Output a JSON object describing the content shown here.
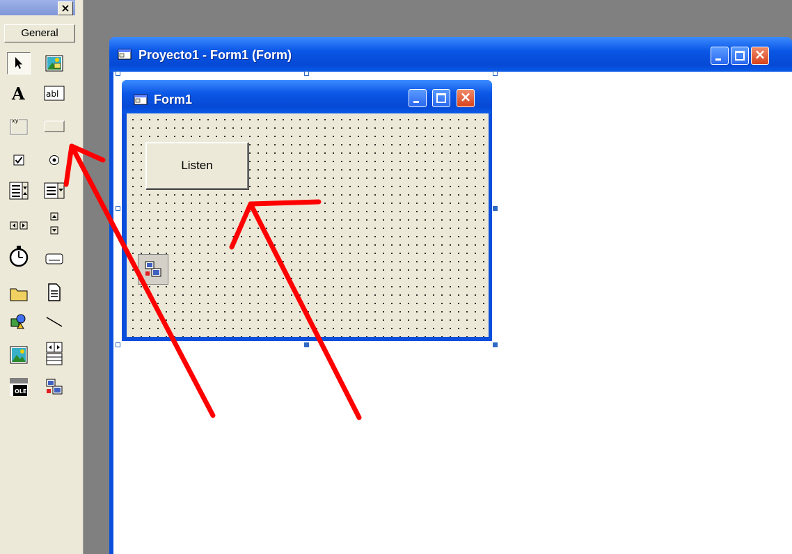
{
  "toolbox": {
    "close_glyph": "×",
    "tab_label": "General",
    "tools": [
      "pointer-icon",
      "picturebox-icon",
      "label-icon",
      "textbox-icon",
      "frame-icon",
      "commandbutton-icon",
      "checkbox-icon",
      "optionbutton-icon",
      "combobox-icon",
      "listbox-icon",
      "hscrollbar-icon",
      "vscrollbar-icon",
      "timer-icon",
      "drivelistbox-icon",
      "dirlistbox-icon",
      "filelistbox-icon",
      "shape-icon",
      "line-icon",
      "image-icon",
      "data-icon",
      "ole-icon",
      "winsock-icon"
    ]
  },
  "project_window": {
    "title": "Proyecto1 - Form1 (Form)"
  },
  "form1": {
    "title": "Form1",
    "listen_button_label": "Listen",
    "winsock_control": "winsock-icon"
  },
  "annotations": {
    "arrow_color": "#ff0000",
    "arrows": [
      "arrow-to-commandbutton-tool",
      "arrow-to-listen-button"
    ]
  },
  "colors": {
    "xp_title_blue": "#0b57e6",
    "form_face": "#ece9d8",
    "desktop_gray": "#808080"
  }
}
